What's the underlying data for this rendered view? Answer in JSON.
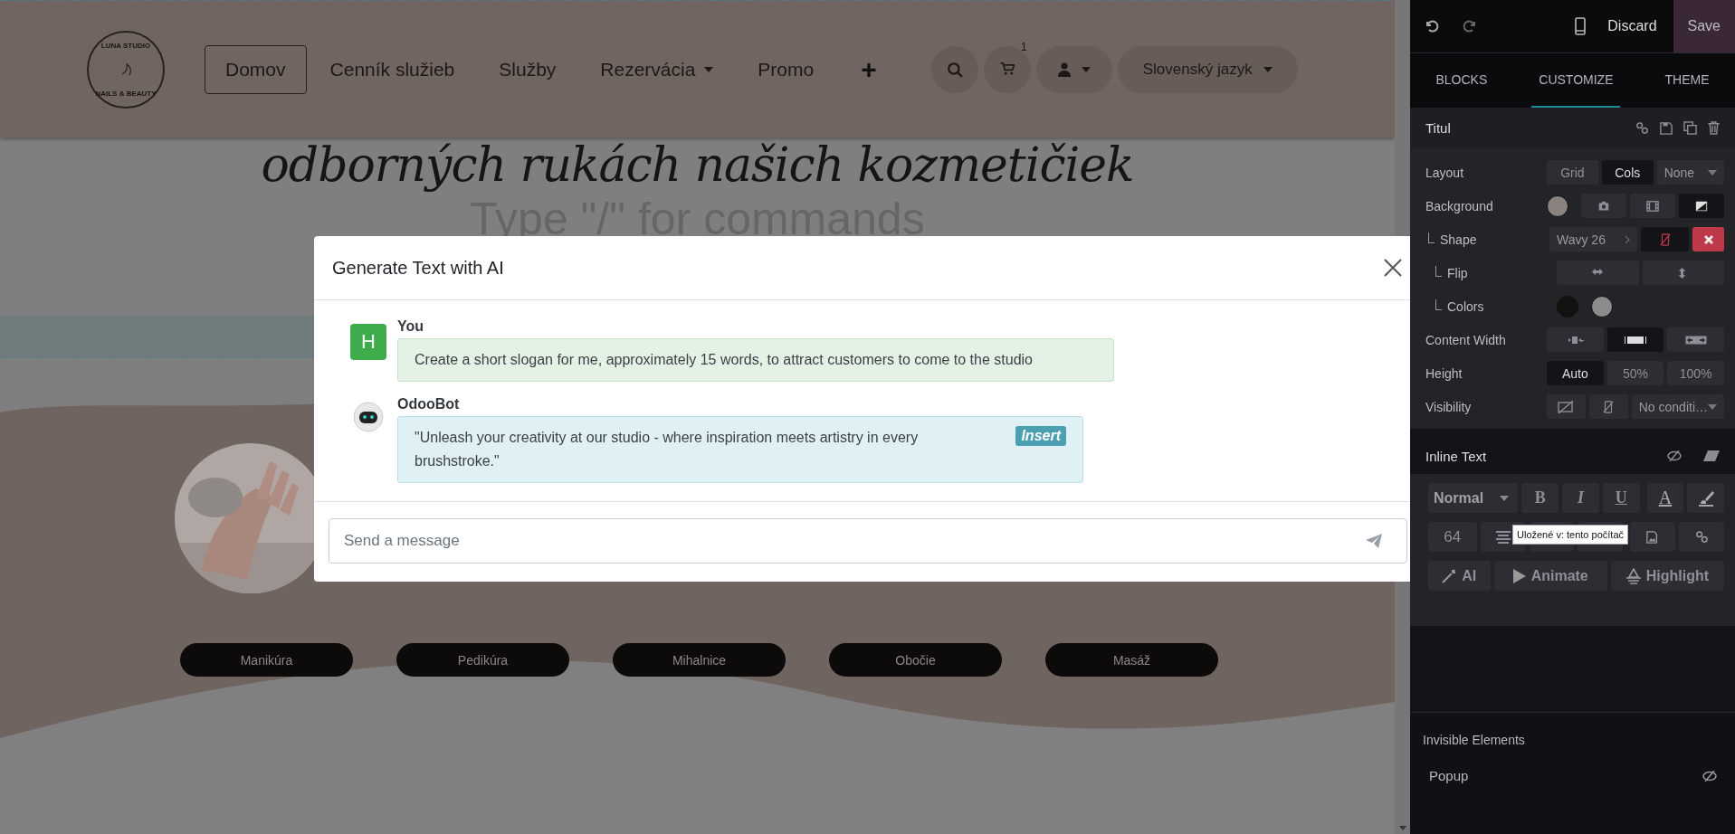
{
  "page": {
    "nav": {
      "logo_top": "LUNA STUDIO",
      "logo_bottom": "NAILS & BEAUTY",
      "items": [
        {
          "label": "Domov",
          "selected": true,
          "dropdown": false
        },
        {
          "label": "Cenník služieb",
          "selected": false,
          "dropdown": false
        },
        {
          "label": "Služby",
          "selected": false,
          "dropdown": false
        },
        {
          "label": "Rezervácia",
          "selected": false,
          "dropdown": true
        },
        {
          "label": "Promo",
          "selected": false,
          "dropdown": false
        }
      ],
      "add": "+",
      "cart_count": "1",
      "language": "Slovenský jazyk"
    },
    "hero": {
      "heading": "odborných rukách našich kozmetičiek",
      "placeholder": "Type \"/\" for commands"
    },
    "services": [
      "Manikúra",
      "Pedikúra",
      "Mihalnice",
      "Obočie",
      "Masáž"
    ]
  },
  "dialog": {
    "title": "Generate Text with AI",
    "messages": [
      {
        "kind": "user",
        "author": "You",
        "avatar": "H",
        "text": "Create a short slogan for me, approximately 15 words, to attract customers to come to the studio"
      },
      {
        "kind": "bot",
        "author": "OdooBot",
        "text": "\"Unleash your creativity at our studio - where inspiration meets artistry in every brushstroke.\"",
        "action": "Insert"
      }
    ],
    "input": {
      "placeholder": "Send a message"
    }
  },
  "editor": {
    "discard": "Discard",
    "save": "Save",
    "tabs": [
      {
        "label": "BLOCKS",
        "selected": false
      },
      {
        "label": "CUSTOMIZE",
        "selected": true
      },
      {
        "label": "THEME",
        "selected": false
      }
    ],
    "section": {
      "title": "Titul",
      "options": [
        {
          "label": "Layout",
          "controls": [
            {
              "kind": "segment",
              "label": "Grid",
              "selected": false
            },
            {
              "kind": "segment",
              "label": "Cols",
              "selected": true
            },
            {
              "kind": "select",
              "label": "None"
            }
          ]
        },
        {
          "label": "Background",
          "controls": [
            {
              "kind": "swatch",
              "color": "#8a827e"
            },
            {
              "kind": "icon",
              "selected": false
            },
            {
              "kind": "icon",
              "selected": false
            },
            {
              "kind": "icon",
              "selected": true
            }
          ],
          "children": [
            {
              "label": "Shape",
              "controls": [
                {
                  "kind": "link",
                  "label": "Wavy 26"
                },
                {
                  "kind": "icon",
                  "selected": true
                },
                {
                  "kind": "danger"
                }
              ],
              "children": [
                {
                  "label": "Flip",
                  "controls": [
                    {
                      "kind": "icon",
                      "selected": false
                    },
                    {
                      "kind": "icon",
                      "selected": false
                    }
                  ]
                },
                {
                  "label": "Colors",
                  "controls": [
                    {
                      "kind": "swatch",
                      "color": "#141210"
                    },
                    {
                      "kind": "swatch",
                      "color": "#8c8c8c"
                    }
                  ]
                }
              ]
            }
          ]
        },
        {
          "label": "Content Width",
          "controls": [
            {
              "kind": "icon",
              "selected": false
            },
            {
              "kind": "icon",
              "selected": true
            },
            {
              "kind": "icon",
              "selected": false
            }
          ]
        },
        {
          "label": "Height",
          "controls": [
            {
              "kind": "segment",
              "label": "Auto",
              "selected": true
            },
            {
              "kind": "segment",
              "label": "50%",
              "selected": false
            },
            {
              "kind": "segment",
              "label": "100%",
              "selected": false
            }
          ]
        },
        {
          "label": "Visibility",
          "controls": [
            {
              "kind": "icon",
              "selected": false
            },
            {
              "kind": "icon",
              "selected": false
            },
            {
              "kind": "select",
              "label": "No conditi…"
            }
          ]
        }
      ]
    },
    "inline_text": {
      "title": "Inline Text",
      "style": "Normal",
      "formats": [
        {
          "label": "B",
          "selected": false
        },
        {
          "label": "I",
          "selected": false
        },
        {
          "label": "U",
          "selected": false
        }
      ],
      "font_color": "A",
      "size": "64",
      "actions": [
        "AI",
        "Animate",
        "Highlight"
      ]
    },
    "tooltip": "Uložené v: tento počítač",
    "invisible": {
      "title": "Invisible Elements",
      "items": [
        "Popup"
      ]
    }
  }
}
